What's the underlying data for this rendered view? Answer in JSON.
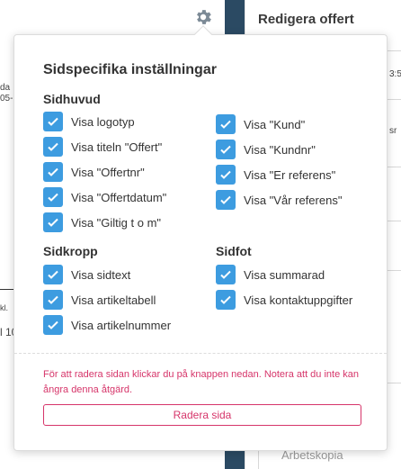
{
  "background": {
    "right_title": "Redigera offert",
    "right_footer": "Arbetskopia",
    "fragments": [
      "da",
      "05-",
      "kl.",
      "l 10",
      "3:5",
      "sr"
    ]
  },
  "popover": {
    "title": "Sidspecifika inställningar",
    "sections": {
      "header": {
        "title": "Sidhuvud",
        "left_options": [
          {
            "label": "Visa logotyp",
            "checked": true
          },
          {
            "label": "Visa titeln \"Offert\"",
            "checked": true
          },
          {
            "label": "Visa \"Offertnr\"",
            "checked": true
          },
          {
            "label": "Visa \"Offertdatum\"",
            "checked": true
          },
          {
            "label": "Visa \"Giltig t o m\"",
            "checked": true
          }
        ],
        "right_options": [
          {
            "label": "Visa \"Kund\"",
            "checked": true
          },
          {
            "label": "Visa \"Kundnr\"",
            "checked": true
          },
          {
            "label": "Visa \"Er referens\"",
            "checked": true
          },
          {
            "label": "Visa \"Vår referens\"",
            "checked": true
          }
        ]
      },
      "body": {
        "title": "Sidkropp",
        "options": [
          {
            "label": "Visa sidtext",
            "checked": true
          },
          {
            "label": "Visa artikeltabell",
            "checked": true
          },
          {
            "label": "Visa artikelnummer",
            "checked": true
          }
        ]
      },
      "footer": {
        "title": "Sidfot",
        "options": [
          {
            "label": "Visa summarad",
            "checked": true
          },
          {
            "label": "Visa kontaktuppgifter",
            "checked": true
          }
        ]
      }
    },
    "warning": "För att radera sidan klickar du på knappen nedan. Notera att du inte kan ångra denna åtgärd.",
    "delete_button": "Radera sida"
  },
  "colors": {
    "checkbox": "#3d9ce0",
    "danger": "#d6356a",
    "sidebar_dark": "#2b4a63"
  }
}
